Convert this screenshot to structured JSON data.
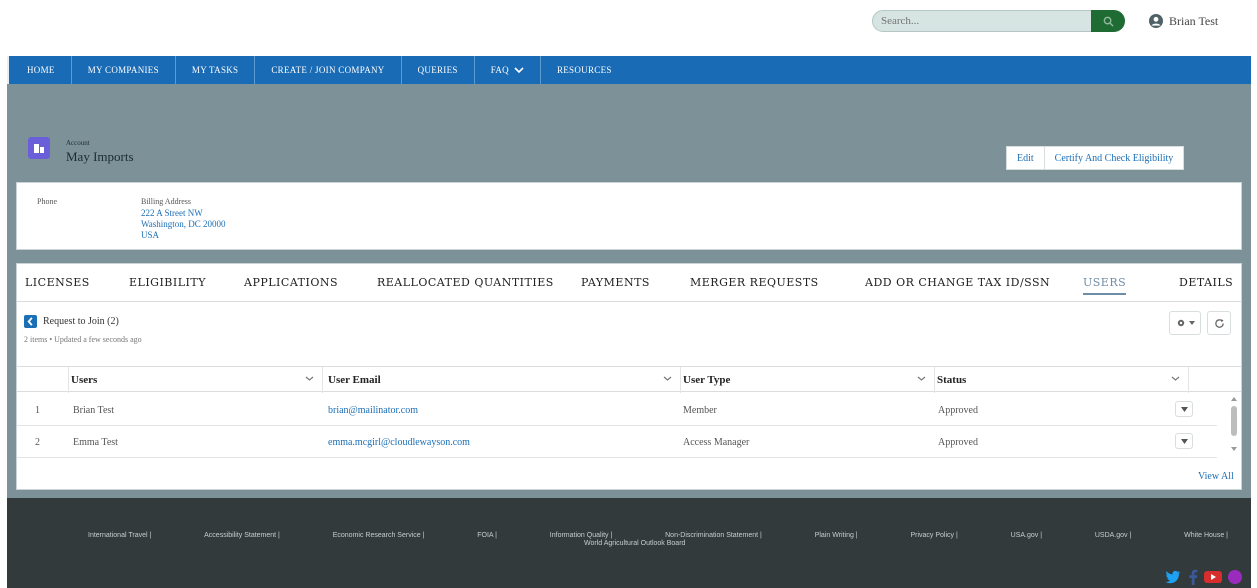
{
  "header": {
    "search_placeholder": "Search...",
    "user_name": "Brian Test"
  },
  "nav": {
    "items": [
      {
        "label": "HOME"
      },
      {
        "label": "MY COMPANIES"
      },
      {
        "label": "MY TASKS"
      },
      {
        "label": "CREATE / JOIN COMPANY"
      },
      {
        "label": "QUERIES"
      },
      {
        "label": "FAQ"
      },
      {
        "label": "RESOURCES"
      }
    ]
  },
  "record": {
    "object_type": "Account",
    "name": "May Imports",
    "actions": {
      "edit": "Edit",
      "certify": "Certify And Check Eligibility"
    },
    "phone_label": "Phone",
    "billing_label": "Billing Address",
    "address": [
      "222 A Street NW",
      "Washington, DC 20000",
      "USA"
    ]
  },
  "tabs": [
    {
      "label": "LICENSES"
    },
    {
      "label": "ELIGIBILITY"
    },
    {
      "label": "APPLICATIONS"
    },
    {
      "label": "REALLOCATED QUANTITIES"
    },
    {
      "label": "PAYMENTS"
    },
    {
      "label": "MERGER REQUESTS"
    },
    {
      "label": "ADD OR CHANGE TAX ID/SSN"
    },
    {
      "label": "USERS"
    },
    {
      "label": "DETAILS"
    }
  ],
  "active_tab": "USERS",
  "related_list": {
    "title": "Request to Join (2)",
    "subtitle": "2 items • Updated a few seconds ago",
    "columns": [
      "Users",
      "User Email",
      "User Type",
      "Status"
    ],
    "rows": [
      {
        "num": "1",
        "user": "Brian Test",
        "email": "brian@mailinator.com",
        "type": "Member",
        "status": "Approved"
      },
      {
        "num": "2",
        "user": "Emma Test",
        "email": "emma.mcgirl@cloudlewayson.com",
        "type": "Access Manager",
        "status": "Approved"
      }
    ],
    "view_all": "View All"
  },
  "footer": {
    "links": [
      "International Travel |",
      "Accessibility Statement |",
      "Economic Research Service |",
      "FOIA |",
      "Information Quality |",
      "Non-Discrimination Statement |",
      "Plain Writing |",
      "Privacy Policy |",
      "USA.gov |",
      "USDA.gov |",
      "White House |"
    ],
    "sub_link": "World Agricultural Outlook Board"
  },
  "colors": {
    "nav": "#1a6bb5",
    "band": "#7d9298",
    "footer": "#333a3c",
    "search_btn": "#1e6b33",
    "link": "#1b6fb5",
    "object_icon": "#6a5fd8"
  }
}
